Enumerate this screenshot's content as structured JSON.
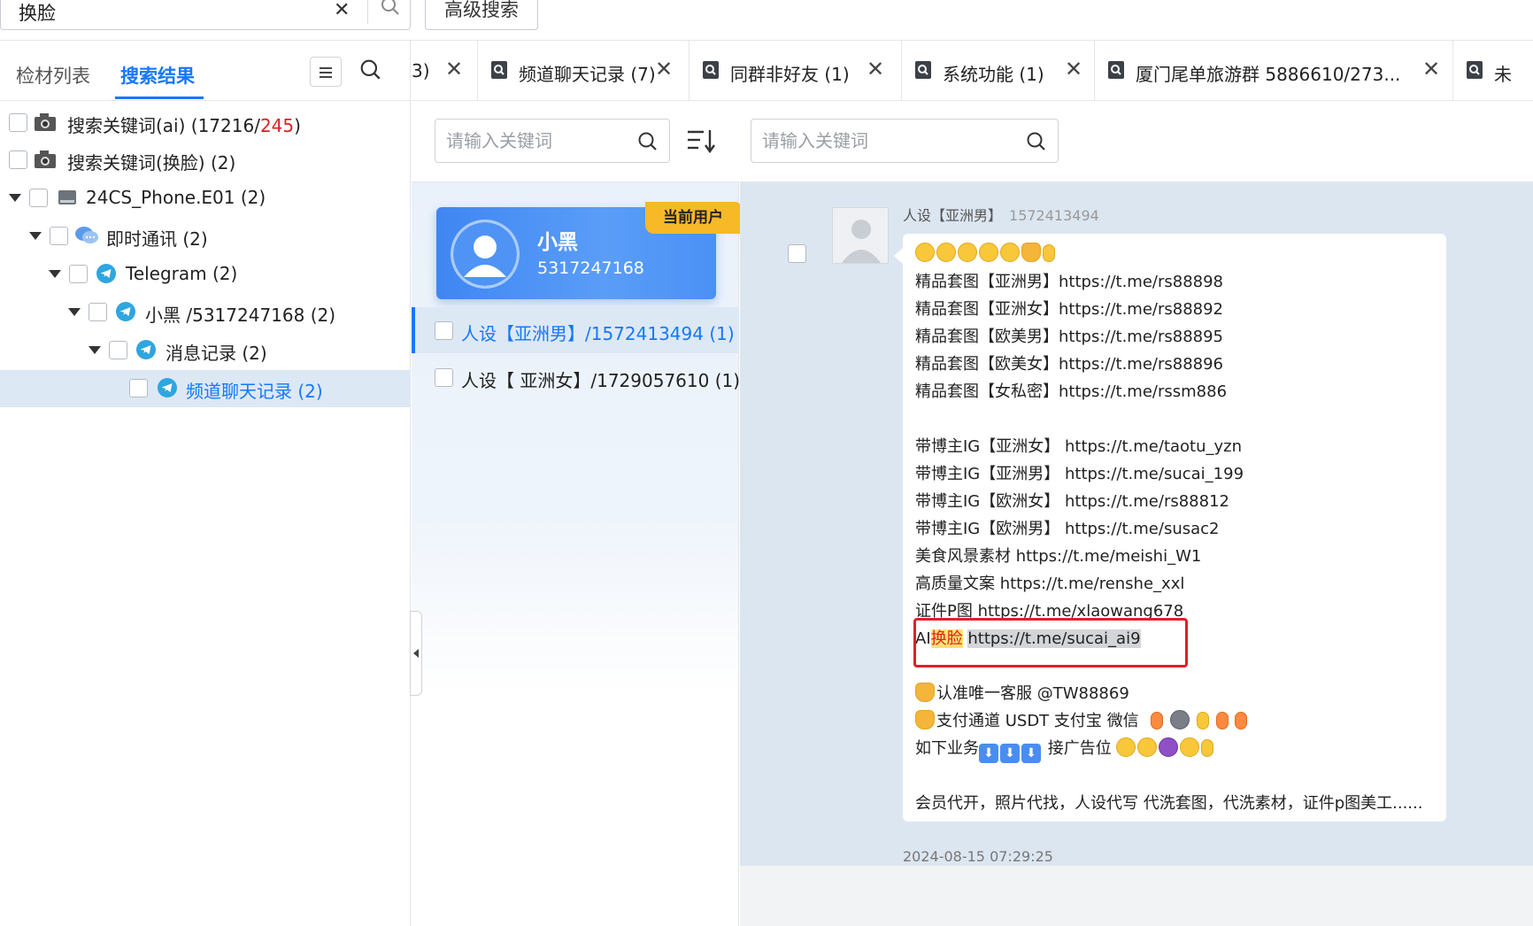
{
  "top": {
    "search_value": "换脸",
    "advanced_search_label": "高级搜索"
  },
  "left": {
    "tabs": [
      "检材列表",
      "搜索结果"
    ],
    "active_tab": "搜索结果",
    "tree": [
      {
        "label": "搜索关键词(ai) (17216/",
        "label_red": "245",
        "label_end": ")",
        "icon": "camera-icon"
      },
      {
        "label": "搜索关键词(换脸) (2)",
        "icon": "camera-icon"
      },
      {
        "label": "24CS_Phone.E01 (2)",
        "icon": "disk-icon"
      },
      {
        "label": "即时通讯 (2)",
        "icon": "chat-bubbles-icon"
      },
      {
        "label": "Telegram (2)",
        "icon": "telegram-icon"
      },
      {
        "label": "小黑 /5317247168 (2)",
        "icon": "telegram-icon"
      },
      {
        "label": "消息记录 (2)",
        "icon": "telegram-icon"
      },
      {
        "label": "频道聊天记录 (2)",
        "icon": "telegram-icon"
      }
    ]
  },
  "tabs": [
    {
      "label": "3)"
    },
    {
      "label": "频道聊天记录 (7)"
    },
    {
      "label": "同群非好友 (1)"
    },
    {
      "label": "系统功能 (1)"
    },
    {
      "label": "厦门尾单旅游群 5886610/273..."
    },
    {
      "label": "未"
    }
  ],
  "middle": {
    "search_placeholder": "请输入关键词",
    "user_card": {
      "name": "小黑",
      "id": "5317247168",
      "badge": "当前用户"
    },
    "contacts": [
      {
        "label": "人设【亚洲男】/1572413494 (1)",
        "selected": true
      },
      {
        "label": "人设【 亚洲女】/1729057610 (1)",
        "selected": false
      }
    ]
  },
  "right": {
    "search_placeholder": "请输入关键词",
    "message": {
      "sender": "人设【亚洲男】",
      "sender_id": "1572413494",
      "lines": [
        "精品套图【亚洲男】https://t.me/rs88898",
        "精品套图【亚洲女】https://t.me/rs88892",
        "精品套图【欧美男】https://t.me/rs88895",
        "精品套图【欧美女】https://t.me/rs88896",
        "精品套图【女私密】https://t.me/rssm886",
        "带博主IG【亚洲女】 https://t.me/taotu_yzn",
        "带博主IG【亚洲男】 https://t.me/sucai_199",
        "带博主IG【欧洲女】 https://t.me/rs88812",
        "带博主IG【欧洲男】 https://t.me/susac2",
        "美食风景素材 https://t.me/meishi_W1",
        "高质量文案 https://t.me/renshe_xxl",
        "证件P图 https://t.me/xlaowang678"
      ],
      "ai_prefix": "AI",
      "ai_keyword": "换脸",
      "ai_link": "https://t.me/sucai_ai9",
      "service_line": "认准唯一客服 @TW88869",
      "pay_line": "支付通道 USDT 支付宝 微信",
      "biz_line_1": "如下业务",
      "biz_line_2": "接广告位",
      "last_line": "会员代开，照片代找，人设代写 代洗套图，代洗素材，证件p图美工......",
      "timestamp": "2024-08-15 07:29:25"
    }
  },
  "colors": {
    "accent": "#1677ff",
    "badge": "#f7b928",
    "highlight_box": "#e0202a"
  }
}
